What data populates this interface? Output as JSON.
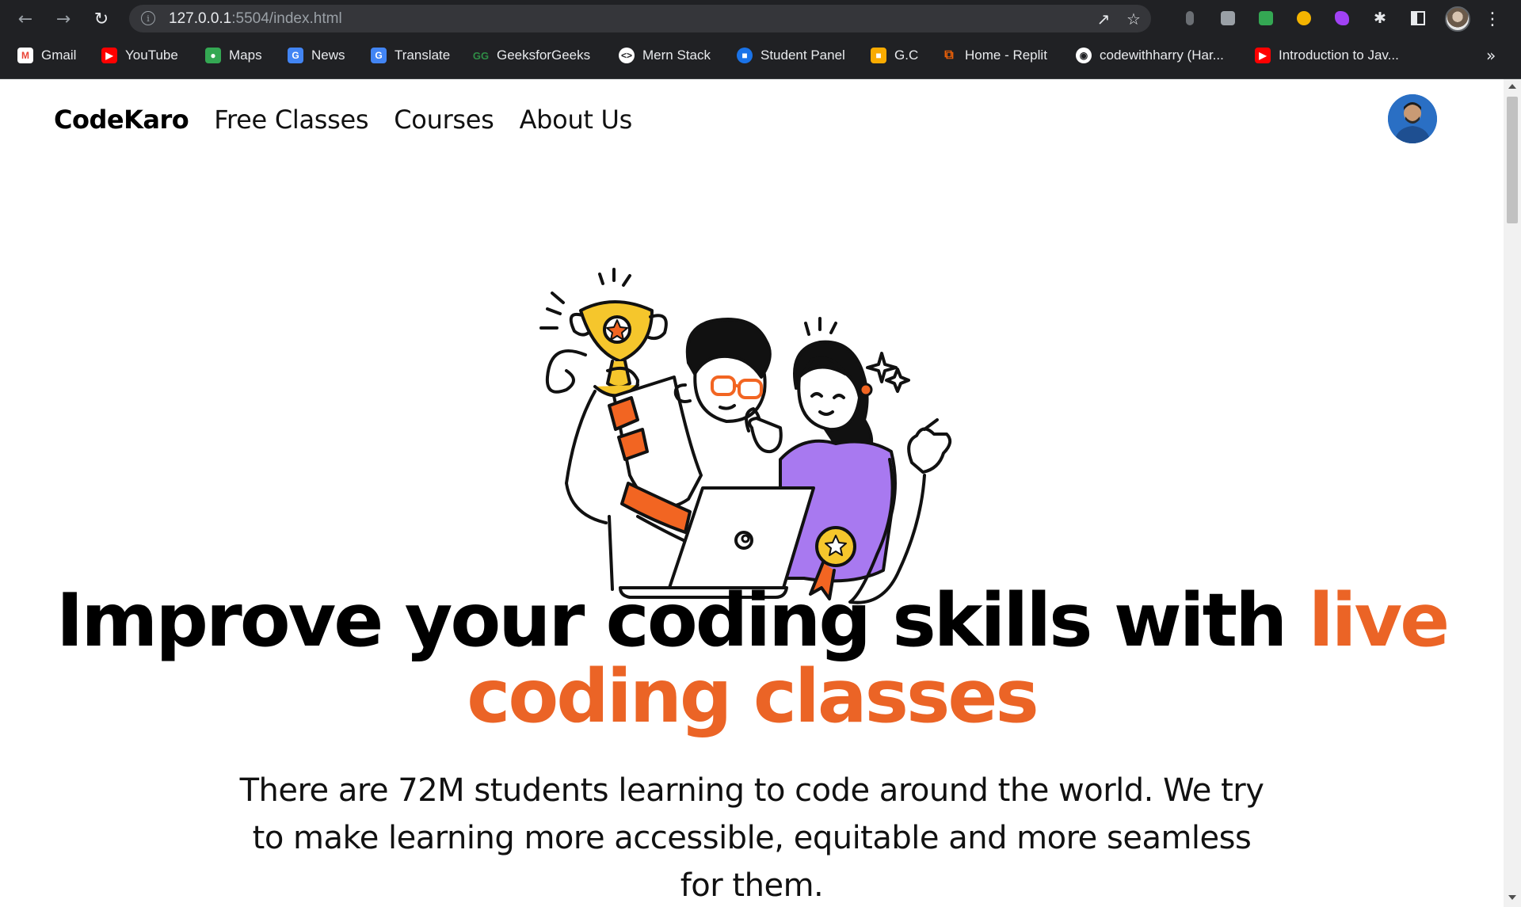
{
  "browser": {
    "url_host": "127.0.0.1",
    "url_rest": ":5504/index.html",
    "nav_icons": [
      "back-icon",
      "forward-icon",
      "reload-icon"
    ],
    "bookmarks": [
      {
        "label": "Gmail",
        "icon": "gmail-icon",
        "color": "#ea4335"
      },
      {
        "label": "YouTube",
        "icon": "youtube-icon",
        "color": "#ff0000"
      },
      {
        "label": "Maps",
        "icon": "maps-icon",
        "color": "#34a853"
      },
      {
        "label": "News",
        "icon": "news-icon",
        "color": "#4285f4"
      },
      {
        "label": "Translate",
        "icon": "translate-icon",
        "color": "#4285f4"
      },
      {
        "label": "GeeksforGeeks",
        "icon": "gfg-icon",
        "color": "#2f8d46"
      },
      {
        "label": "Mern Stack",
        "icon": "mern-icon",
        "color": "#ffffff"
      },
      {
        "label": "Student Panel",
        "icon": "student-panel-icon",
        "color": "#1a73e8"
      },
      {
        "label": "G.C",
        "icon": "classroom-icon",
        "color": "#f9ab00"
      },
      {
        "label": "Home - Replit",
        "icon": "replit-icon",
        "color": "#f26207"
      },
      {
        "label": "codewithharry (Har...",
        "icon": "codewithharry-icon",
        "color": "#ffffff"
      },
      {
        "label": "Introduction to Jav...",
        "icon": "youtube-icon",
        "color": "#ff0000"
      }
    ]
  },
  "site": {
    "brand": "CodeKaro",
    "nav": [
      "Free Classes",
      "Courses",
      "About Us"
    ],
    "headline_main": "Improve your coding skills with ",
    "headline_accent": "live coding classes",
    "subtext": "There are 72M students learning to code around the world. We try to make learning more accessible, equitable and more seamless for them.",
    "accent_color": "#eb6426"
  }
}
